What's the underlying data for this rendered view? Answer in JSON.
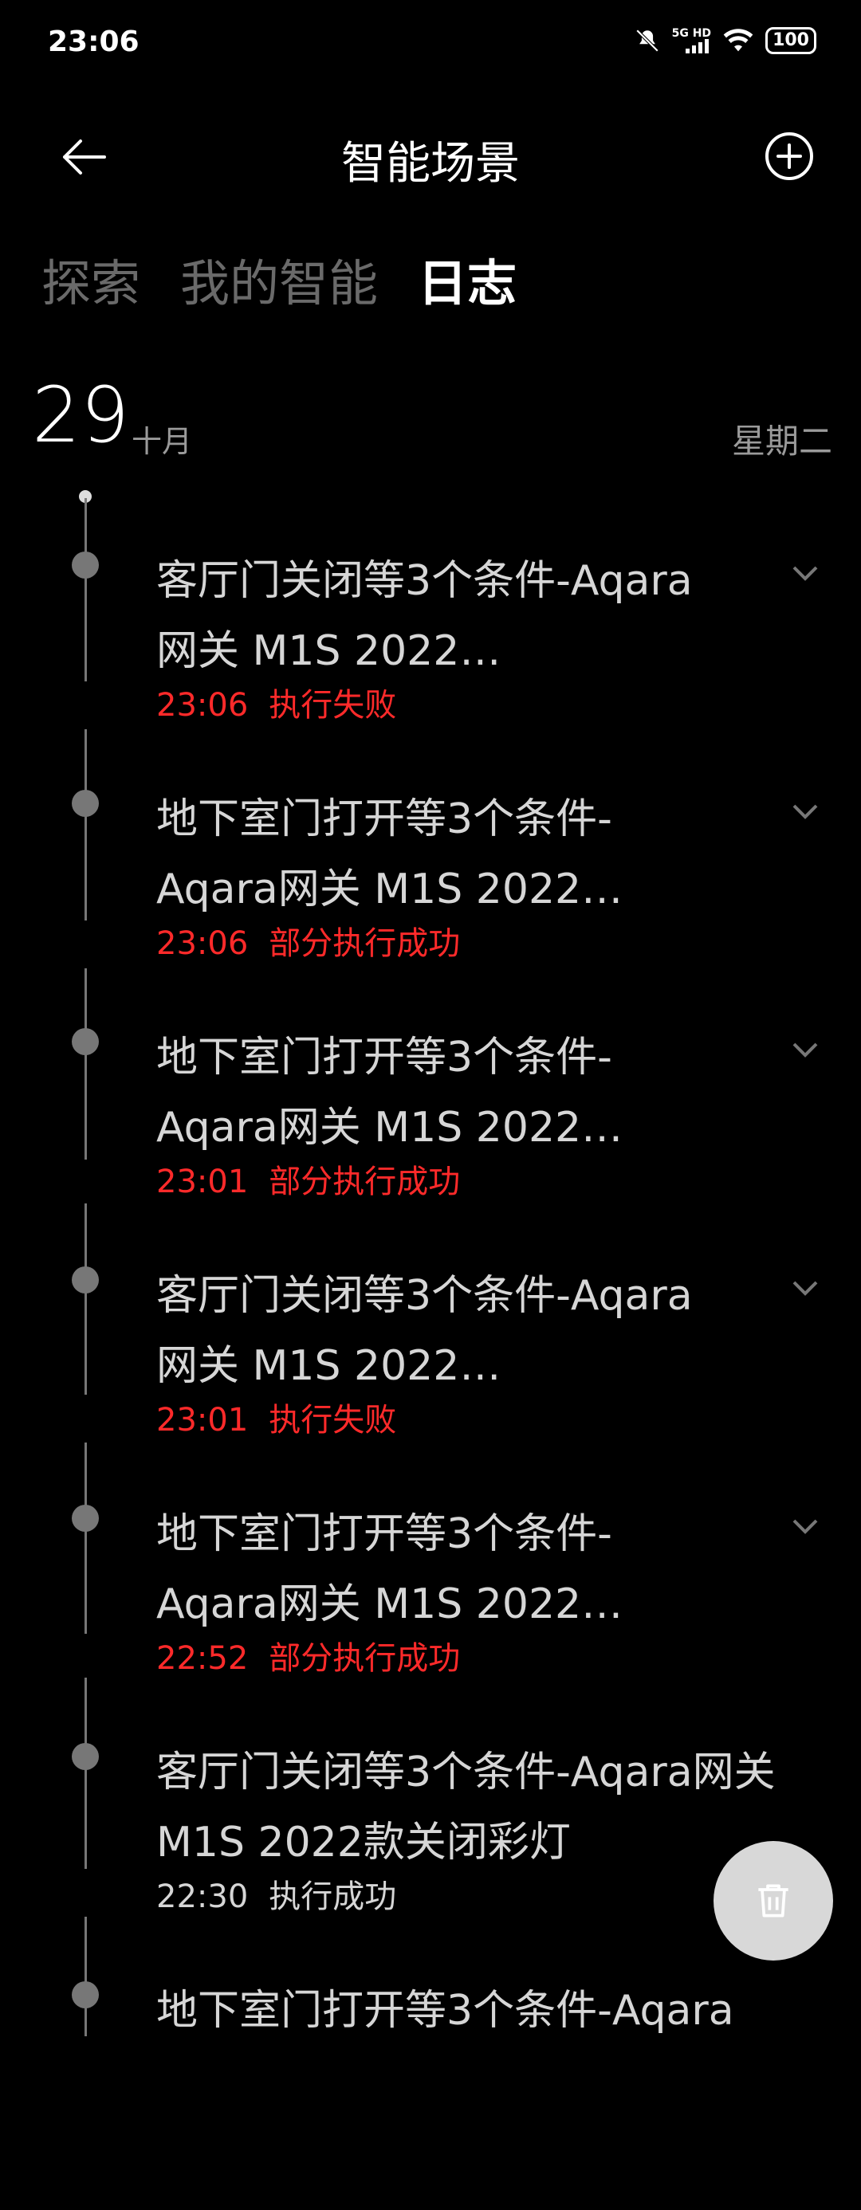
{
  "status_bar": {
    "time": "23:06",
    "network": "5G HD",
    "battery": "100"
  },
  "header": {
    "title": "智能场景"
  },
  "tabs": [
    {
      "label": "探索",
      "active": false
    },
    {
      "label": "我的智能",
      "active": false
    },
    {
      "label": "日志",
      "active": true
    }
  ],
  "date": {
    "day": "29",
    "month": "十月",
    "weekday": "星期二"
  },
  "log_entries": [
    {
      "name": "客厅门关闭等3个条件-Aqara网关 M1S 2022…",
      "time": "23:06",
      "status": "执行失败"
    },
    {
      "name": "地下室门打开等3个条件-Aqara网关 M1S 2022…",
      "time": "23:06",
      "status": "部分执行成功"
    },
    {
      "name": "地下室门打开等3个条件-Aqara网关 M1S 2022…",
      "time": "23:01",
      "status": "部分执行成功"
    },
    {
      "name": "客厅门关闭等3个条件-Aqara网关 M1S 2022…",
      "time": "23:01",
      "status": "执行失败"
    },
    {
      "name": "地下室门打开等3个条件-Aqara网关 M1S 2022…",
      "time": "22:52",
      "status": "部分执行成功"
    },
    {
      "name": "客厅门关闭等3个条件-Aqara网关 M1S 2022款关闭彩灯",
      "time": "22:30",
      "status": "执行成功"
    },
    {
      "name": "地下室门打开等3个条件-Aqara",
      "time": "",
      "status": ""
    }
  ],
  "colors": {
    "background": "#000000",
    "error": "#ff2a2a",
    "muted": "#6a6a6a"
  }
}
